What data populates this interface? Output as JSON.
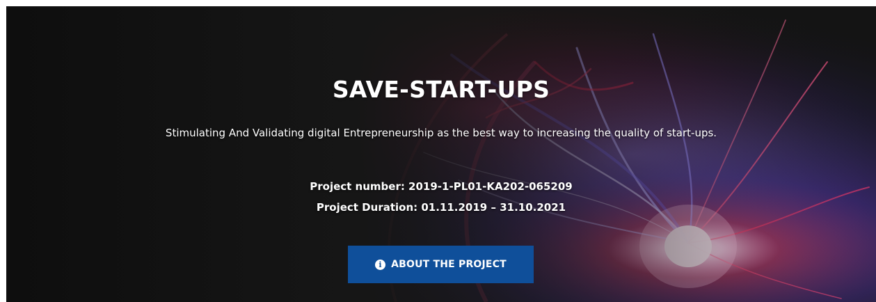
{
  "hero": {
    "title": "SAVE-START-UPS",
    "subtitle": "Stimulating And Validating digital Entrepreneurship as the best way to increasing the quality of start-ups.",
    "project_number": "Project number: 2019-1-PL01-KA202-065209",
    "project_duration": "Project Duration: 01.11.2019 – 31.10.2021",
    "cta": {
      "label": "ABOUT THE PROJECT",
      "icon": "info-circle-icon"
    }
  },
  "colors": {
    "button_bg": "#0f4f9a",
    "text": "#ffffff",
    "background": "#121212",
    "plasma_pink": "#ff3c78",
    "plasma_violet": "#8a78ff"
  }
}
